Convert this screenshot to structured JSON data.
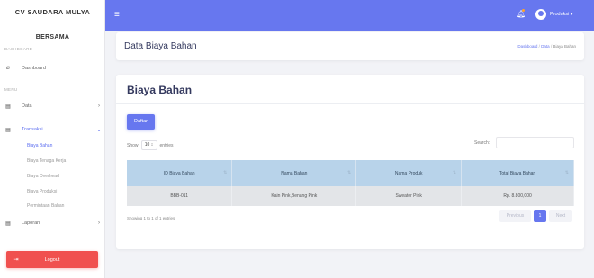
{
  "sidebar": {
    "brand": "CV SAUDARA MULYA",
    "brand_sub": "BERSAMA",
    "section_dashboard": "DASHBOARD",
    "section_menu": "MENU",
    "items": [
      {
        "label": "Dashboard",
        "icon": "fire-icon"
      },
      {
        "label": "Data",
        "icon": "table-icon"
      },
      {
        "label": "Transaksi",
        "icon": "table-icon"
      },
      {
        "label": "Laporan",
        "icon": "table-icon"
      }
    ],
    "sub_items": [
      "Biaya Bahan",
      "Biaya Tenaga Kerja",
      "Biaya Overhead",
      "Biaya Produksi",
      "Permintaan Bahan"
    ],
    "logout": "Logout"
  },
  "topbar": {
    "user": "Produksi"
  },
  "header": {
    "title": "Data Biaya Bahan",
    "breadcrumb": [
      "Dashboard",
      "Data",
      "Biaya Bahan"
    ]
  },
  "card": {
    "title": "Biaya Bahan",
    "daftar_label": "Daftar",
    "show_label": "Show",
    "length_value": "10",
    "entries_label": "entries",
    "search_label": "Search:",
    "columns": [
      "ID Biaya Bahan",
      "Nama Bahan",
      "Nama Produk",
      "Total Biaya Bahan"
    ],
    "rows": [
      [
        "BBB-011",
        "Kain Pink,Benang Pink",
        "Sweater Pink",
        "Rp. 8.800,000"
      ]
    ],
    "info": "Showing 1 to 1 of 1 entries",
    "pagination": {
      "prev": "Previous",
      "current": "1",
      "next": "Next"
    }
  },
  "colors": {
    "primary": "#6777ef",
    "danger": "#f0504f",
    "table_header": "#b8d3ea"
  }
}
